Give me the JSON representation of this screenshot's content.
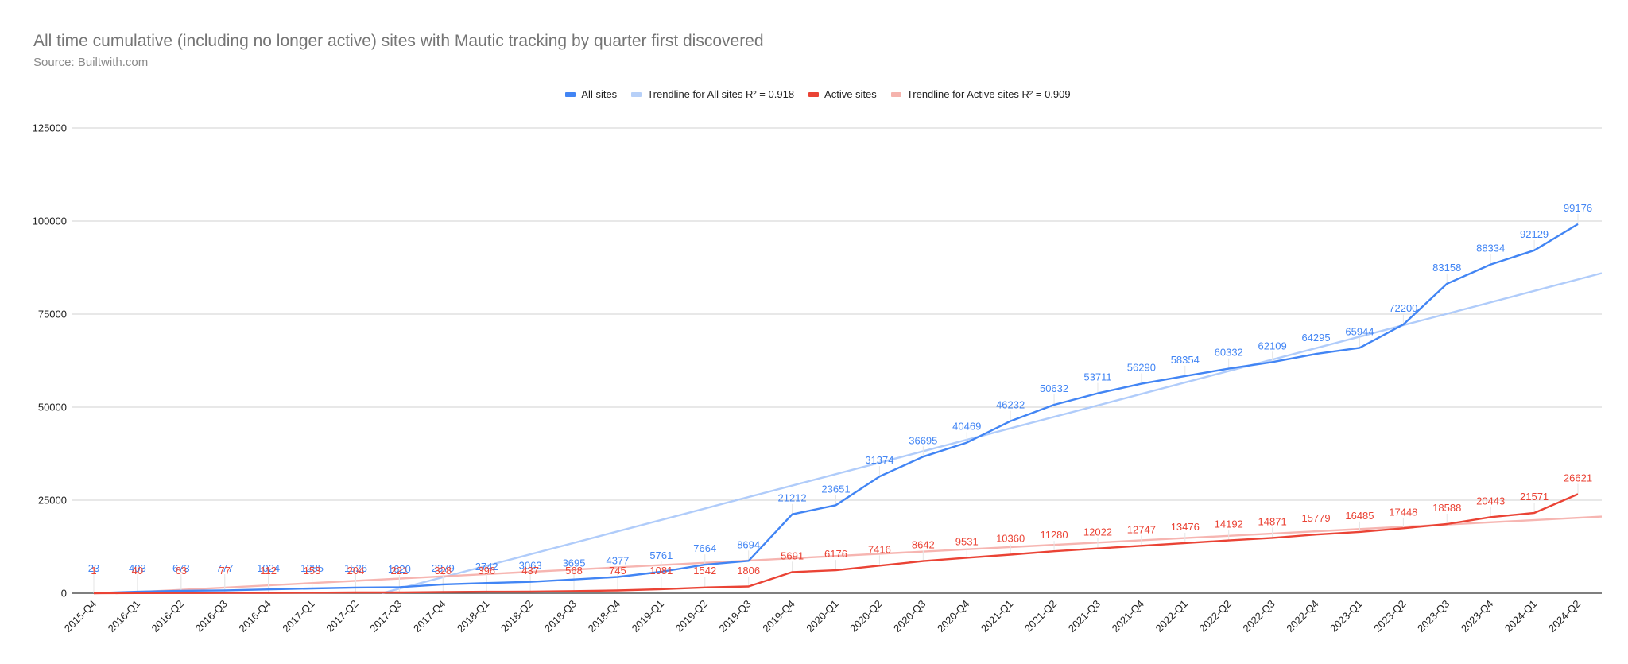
{
  "chart_data": {
    "type": "line",
    "title": "All time cumulative (including no longer active) sites with Mautic tracking by quarter first discovered",
    "subtitle": "Source: Builtwith.com",
    "xlabel": "",
    "ylabel": "",
    "ylim": [
      0,
      125000
    ],
    "yticks": [
      0,
      25000,
      50000,
      75000,
      100000,
      125000
    ],
    "grid": true,
    "legend_position": "top",
    "categories": [
      "2015-Q4",
      "2016-Q1",
      "2016-Q2",
      "2016-Q3",
      "2016-Q4",
      "2017-Q1",
      "2017-Q2",
      "2017-Q3",
      "2017-Q4",
      "2018-Q1",
      "2018-Q2",
      "2018-Q3",
      "2018-Q4",
      "2019-Q1",
      "2019-Q2",
      "2019-Q3",
      "2019-Q4",
      "2020-Q1",
      "2020-Q2",
      "2020-Q3",
      "2020-Q4",
      "2021-Q1",
      "2021-Q2",
      "2021-Q3",
      "2021-Q4",
      "2022-Q1",
      "2022-Q2",
      "2022-Q3",
      "2022-Q4",
      "2023-Q1",
      "2023-Q2",
      "2023-Q3",
      "2023-Q4",
      "2024-Q1",
      "2024-Q2"
    ],
    "series": [
      {
        "name": "All sites",
        "color": "#4285f4",
        "values": [
          23,
          403,
          673,
          777,
          1024,
          1285,
          1526,
          1620,
          2379,
          2742,
          3063,
          3695,
          4377,
          5761,
          7664,
          8694,
          21212,
          23651,
          31374,
          36695,
          40469,
          46232,
          50632,
          53711,
          56290,
          58354,
          60332,
          62109,
          64295,
          65944,
          72200,
          83158,
          88334,
          92129,
          99176
        ]
      },
      {
        "name": "Active sites",
        "color": "#ea4335",
        "values": [
          1,
          40,
          63,
          77,
          112,
          153,
          204,
          221,
          328,
          396,
          437,
          568,
          745,
          1081,
          1542,
          1806,
          5691,
          6176,
          7416,
          8642,
          9531,
          10360,
          11280,
          12022,
          12747,
          13476,
          14192,
          14871,
          15779,
          16485,
          17448,
          18588,
          20443,
          21571,
          26621
        ]
      }
    ],
    "trendlines": [
      {
        "name": "Trendline for All sites R² = 0.918",
        "color": "#a8c7fa",
        "r2": 0.918,
        "start": {
          "x_index": 6.6,
          "y": 0
        },
        "end": {
          "x_index": 35.8,
          "y": 86000
        }
      },
      {
        "name": "Trendline for Active sites R² = 0.909",
        "color": "#f6aea9",
        "r2": 0.909,
        "start": {
          "x_index": 0.5,
          "y": 0
        },
        "end": {
          "x_index": 35.8,
          "y": 20600
        }
      }
    ],
    "legend": [
      {
        "label": "All sites",
        "color": "#4285f4"
      },
      {
        "label": "Trendline for All sites R² = 0.918",
        "color": "#b7d0f8"
      },
      {
        "label": "Active sites",
        "color": "#ea4335"
      },
      {
        "label": "Trendline for Active sites R² = 0.909",
        "color": "#f5b3ad"
      }
    ]
  }
}
